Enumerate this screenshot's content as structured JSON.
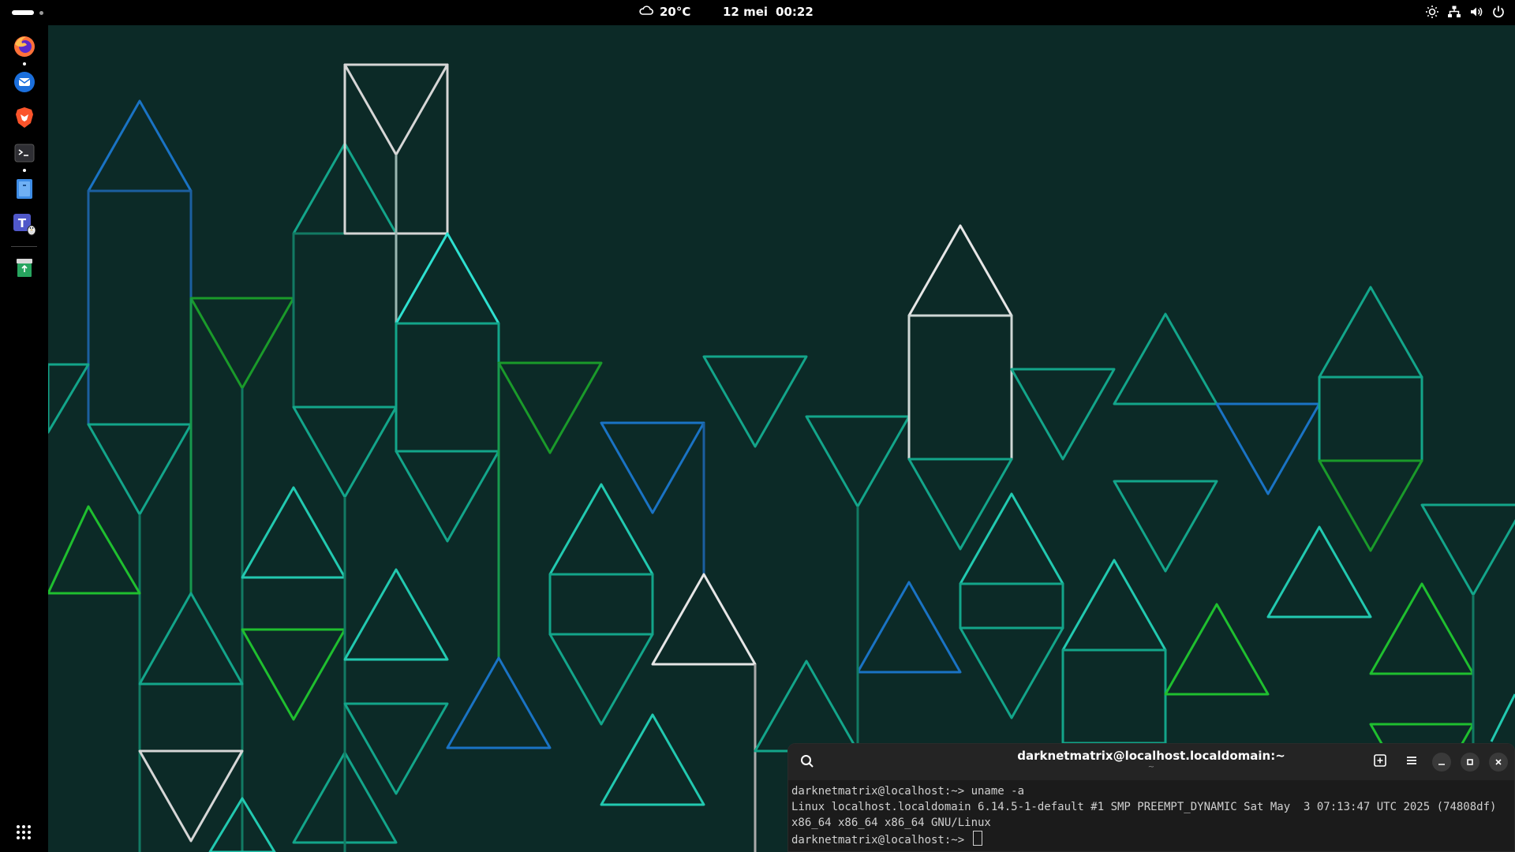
{
  "topbar": {
    "weather": {
      "icon": "cloud-icon",
      "temperature": "20°C"
    },
    "clock": {
      "date": "12 mei",
      "time": "00:22"
    },
    "tray_icons": [
      "brightness-icon",
      "network-icon",
      "volume-icon",
      "power-icon"
    ]
  },
  "dock": {
    "apps": [
      {
        "name": "Firefox",
        "icon": "firefox-icon",
        "running": true
      },
      {
        "name": "Thunderbird",
        "icon": "thunderbird-icon",
        "running": false
      },
      {
        "name": "Brave",
        "icon": "brave-icon",
        "running": false
      },
      {
        "name": "Terminal",
        "icon": "terminal-icon",
        "running": true
      },
      {
        "name": "Files",
        "icon": "files-icon",
        "running": false
      },
      {
        "name": "Teams for Linux",
        "icon": "teams-icon",
        "running": false
      }
    ],
    "trash": {
      "name": "Trash",
      "icon": "trash-icon"
    },
    "app_grid": {
      "icon": "app-grid-icon"
    }
  },
  "terminal": {
    "title": "darknetmatrix@localhost.localdomain:~",
    "subtitle": "~",
    "lines": [
      "darknetmatrix@localhost:~> uname -a",
      "Linux localhost.localdomain 6.14.5-1-default #1 SMP PREEMPT_DYNAMIC Sat May  3 07:13:47 UTC 2025 (74808df) x86_64 x86_64 x86_64 GNU/Linux"
    ],
    "prompt": "darknetmatrix@localhost:~> "
  },
  "colors": {
    "background": "#0c2a27",
    "line_teal": "#13a58a",
    "line_green": "#1fbf2f",
    "line_blue": "#1a73c4",
    "line_white": "#e6e6e6"
  }
}
